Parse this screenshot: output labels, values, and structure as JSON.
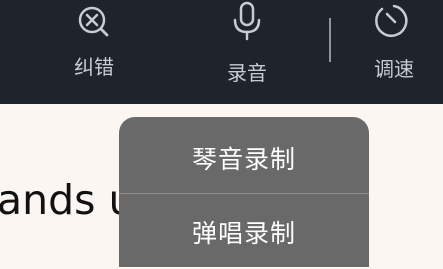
{
  "toolbar": {
    "proofread": {
      "label": "纠错",
      "icon": "search-x-icon"
    },
    "record": {
      "label": "录音",
      "icon": "microphone-icon"
    },
    "speed": {
      "label": "调速",
      "icon": "speed-dial-icon"
    }
  },
  "lyrics": {
    "current_line": "ands up"
  },
  "record_menu": {
    "items": [
      {
        "label": "琴音录制"
      },
      {
        "label": "弹唱录制"
      }
    ]
  },
  "colors": {
    "toolbar_bg": "#1f232c",
    "toolbar_text": "#c7ccd2",
    "page_bg": "#fbf6f2",
    "menu_bg": "#696969",
    "menu_text": "#ffffff"
  }
}
